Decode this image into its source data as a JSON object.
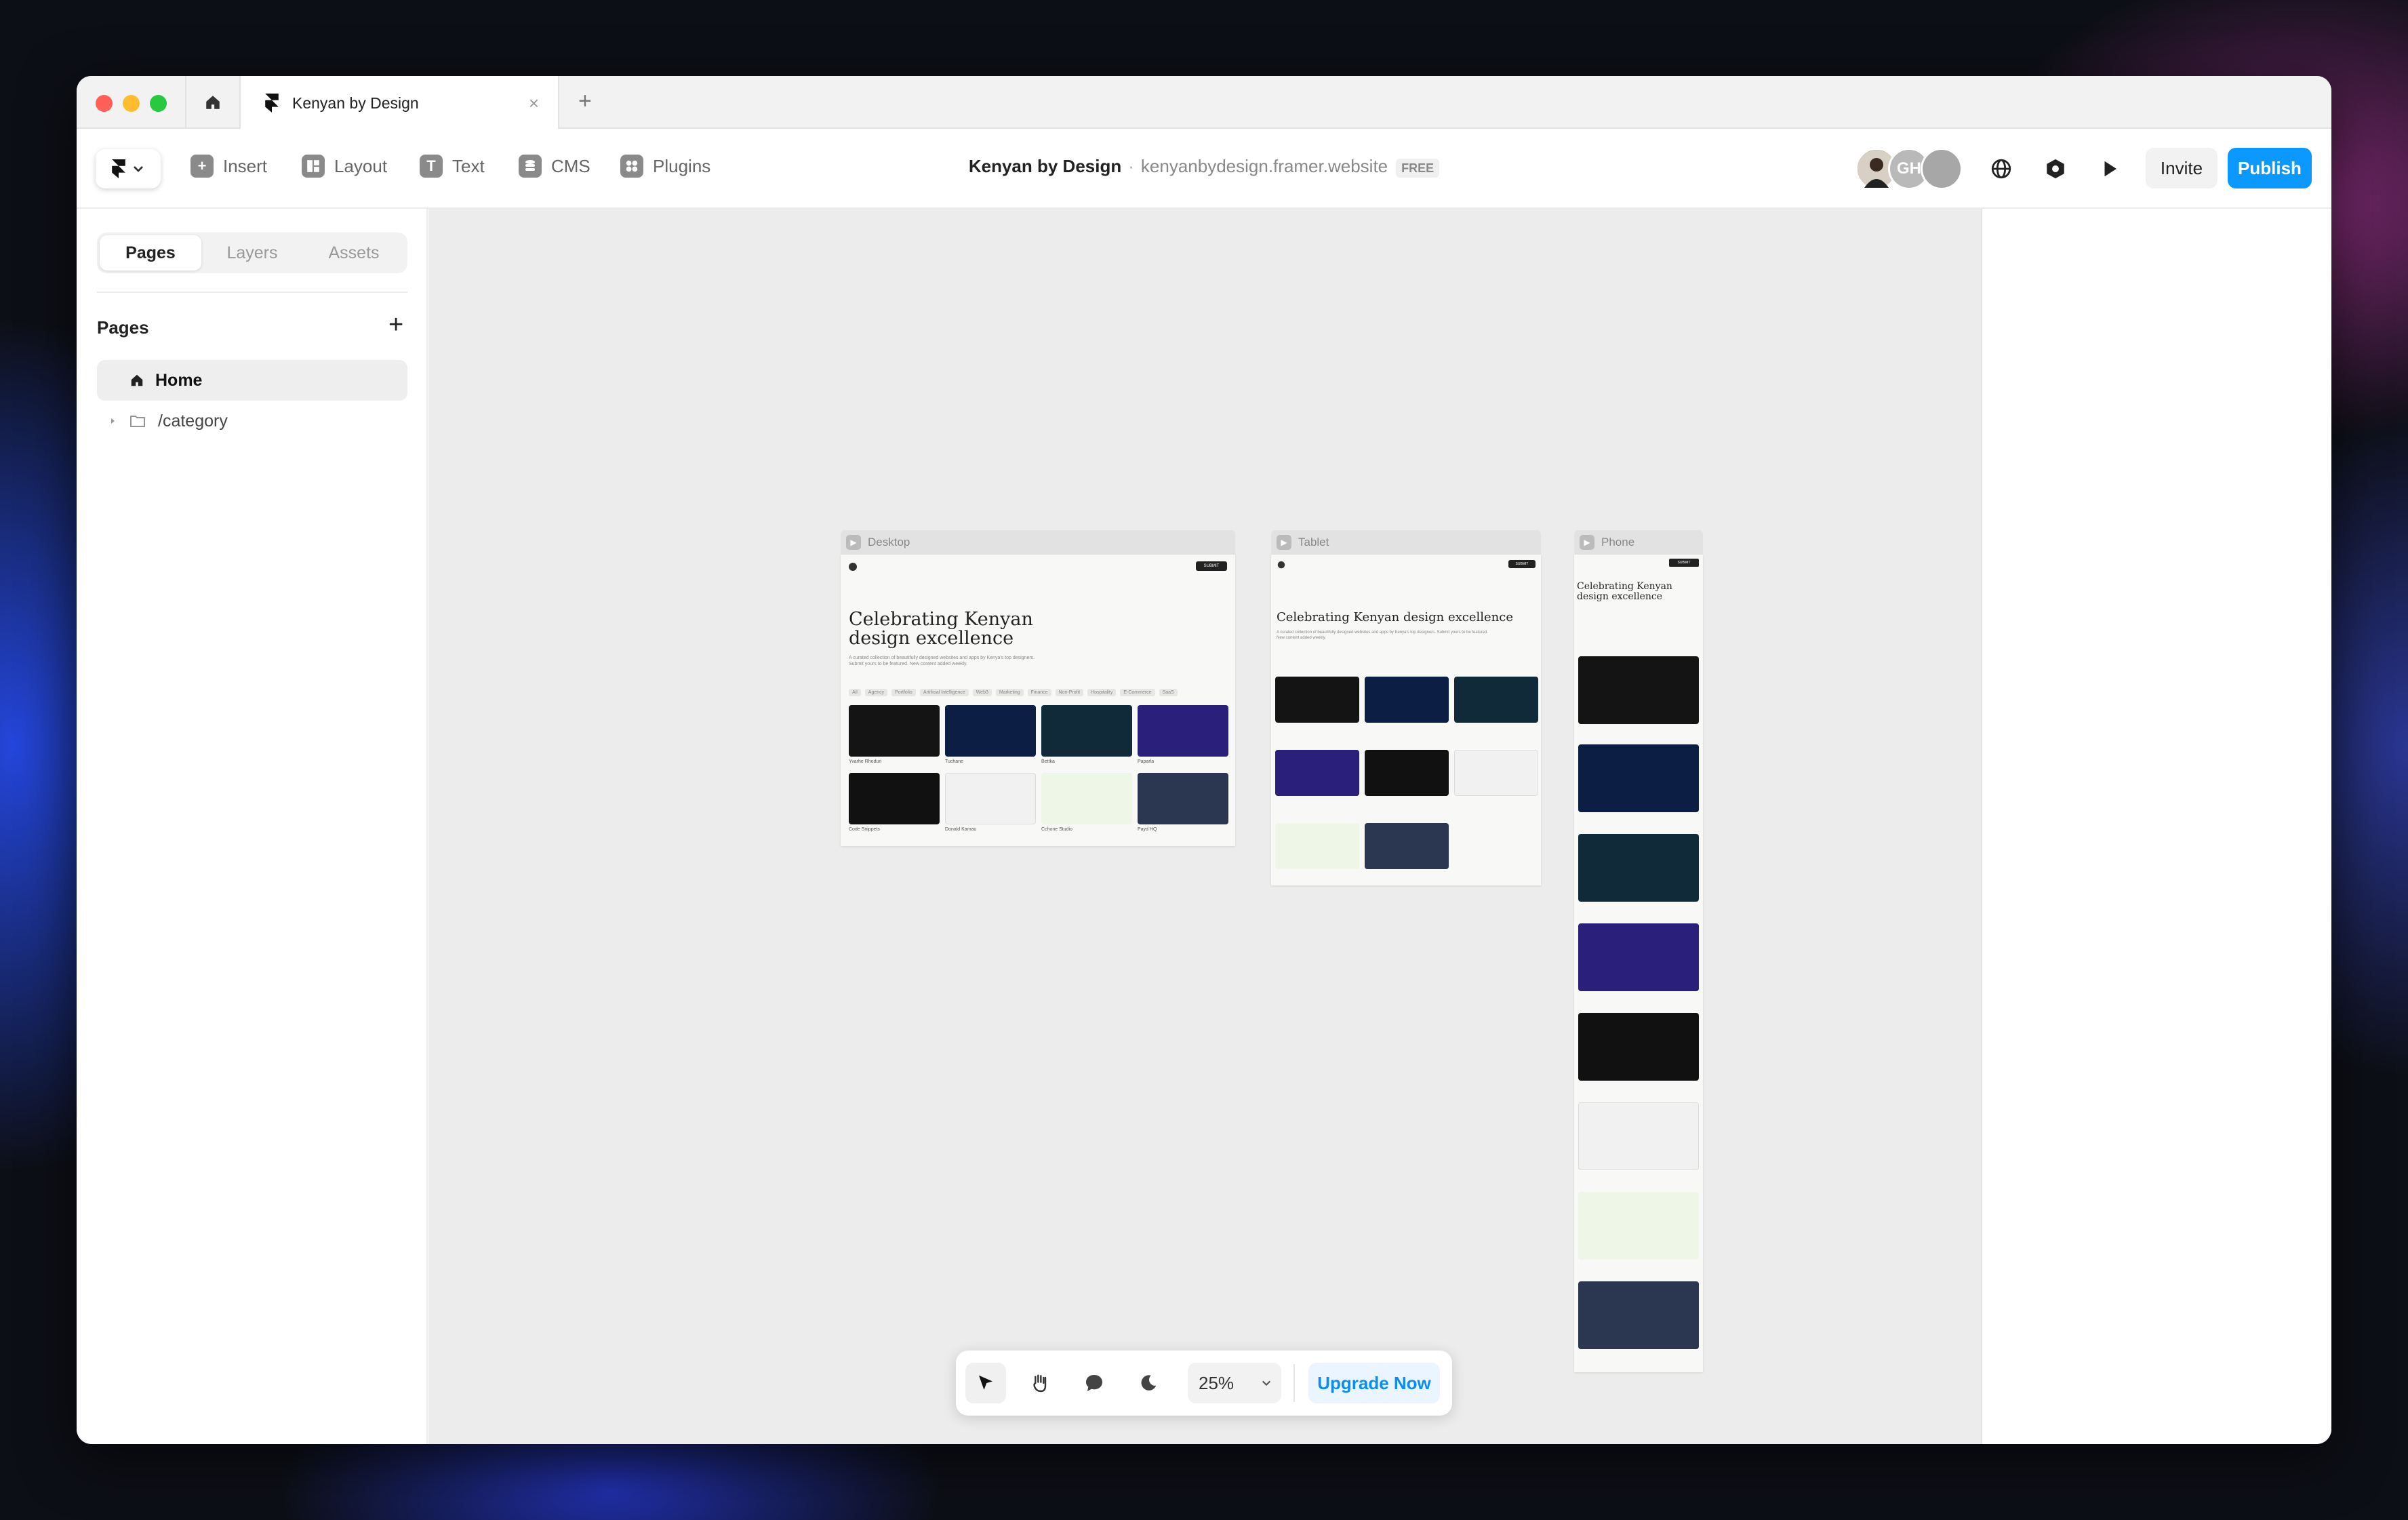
{
  "tab": {
    "title": "Kenyan by Design",
    "close": "×",
    "new": "+"
  },
  "toolbar": {
    "items": [
      "Insert",
      "Layout",
      "Text",
      "CMS",
      "Plugins"
    ],
    "project_name": "Kenyan by Design",
    "separator": "·",
    "project_url": "kenyanbydesign.framer.website",
    "plan_badge": "FREE",
    "avatar_initials": "GH",
    "invite_label": "Invite",
    "publish_label": "Publish"
  },
  "sidebar": {
    "tabs": [
      "Pages",
      "Layers",
      "Assets"
    ],
    "pages_heading": "Pages",
    "add": "+",
    "pages": [
      "Home",
      "/category"
    ]
  },
  "frames": {
    "desktop": "Desktop",
    "tablet": "Tablet",
    "phone": "Phone",
    "submit": "SUBMIT",
    "hero_title": "Celebrating Kenyan design excellence",
    "hero_text": "A curated collection of beautifully designed websites and apps by Kenya's top designers. Submit yours to be featured. New content added weekly.",
    "filters": [
      "All",
      "Agency",
      "Portfolio",
      "Artificial Intelligence",
      "Web3",
      "Marketing",
      "Finance",
      "Non-Profit",
      "Hospitality",
      "E-Commerce",
      "SaaS"
    ],
    "cards": [
      "Yvarhe Rhoduri",
      "Tuchane",
      "Bettka",
      "Paparla",
      "Code Snippets",
      "Donald Kamau",
      "Cchone Studio",
      "Payd HQ"
    ]
  },
  "bottombar": {
    "zoom": "25%",
    "upgrade_label": "Upgrade Now"
  },
  "colors": {
    "accent": "#0b99ff",
    "upgrade_text": "#0b8cf0"
  }
}
